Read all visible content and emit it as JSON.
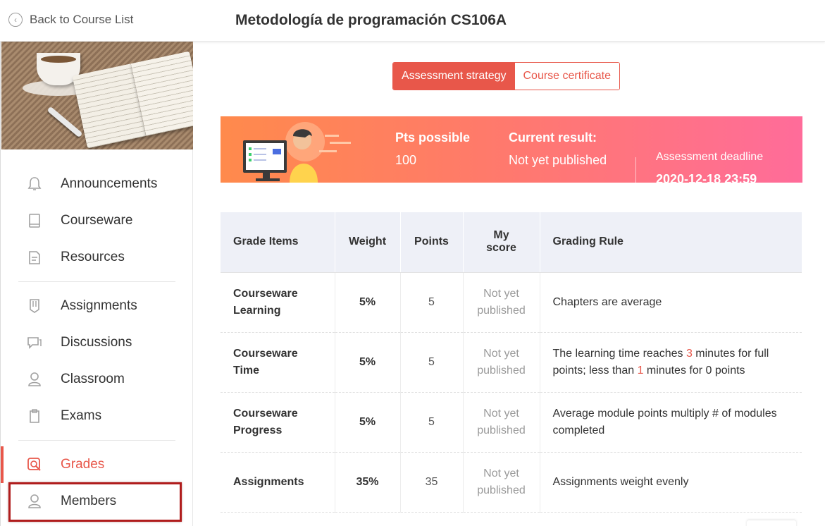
{
  "header": {
    "back_label": "Back to Course List",
    "course_title": "Metodología de programación CS106A"
  },
  "sidebar": {
    "items": [
      {
        "label": "Announcements",
        "icon": "bell-icon"
      },
      {
        "label": "Courseware",
        "icon": "book-icon"
      },
      {
        "label": "Resources",
        "icon": "folder-icon"
      },
      {
        "label": "Assignments",
        "icon": "assignment-icon"
      },
      {
        "label": "Discussions",
        "icon": "chat-icon"
      },
      {
        "label": "Classroom",
        "icon": "classroom-icon"
      },
      {
        "label": "Exams",
        "icon": "clipboard-icon"
      },
      {
        "label": "Grades",
        "icon": "grades-icon",
        "active": true
      },
      {
        "label": "Members",
        "icon": "user-icon"
      }
    ]
  },
  "tabs": {
    "assessment": "Assessment strategy",
    "certificate": "Course certificate"
  },
  "banner": {
    "pts_label": "Pts possible",
    "pts_value": "100",
    "current_label": "Current result:",
    "current_value": "Not yet published",
    "deadline_label": "Assessment deadline",
    "deadline_value": "2020-12-18 23:59"
  },
  "table": {
    "headers": {
      "item": "Grade Items",
      "weight": "Weight",
      "points": "Points",
      "score_1": "My",
      "score_2": "score",
      "rule": "Grading Rule"
    },
    "rows": [
      {
        "item_1": "Courseware",
        "item_2": "Learning",
        "weight": "5%",
        "points": "5",
        "score_1": "Not yet",
        "score_2": "published",
        "rule": "Chapters are average"
      },
      {
        "item_1": "Courseware",
        "item_2": "Time",
        "weight": "5%",
        "points": "5",
        "score_1": "Not yet",
        "score_2": "published",
        "rule_a": "The learning time reaches ",
        "rule_n1": "3",
        "rule_b": " minutes for full points; less than ",
        "rule_n2": "1",
        "rule_c": " minutes for 0 points"
      },
      {
        "item_1": "Courseware",
        "item_2": "Progress",
        "weight": "5%",
        "points": "5",
        "score_1": "Not yet",
        "score_2": "published",
        "rule": "Average module points multiply # of modules completed"
      },
      {
        "item_1": "Assignments",
        "item_2": "",
        "weight": "35%",
        "points": "35",
        "score_1": "Not yet",
        "score_2": "published",
        "rule": "Assignments weight evenly"
      }
    ]
  },
  "colors": {
    "accent": "#e8574a",
    "banner_start": "#ff8a4c",
    "banner_end": "#ff6c9a"
  }
}
